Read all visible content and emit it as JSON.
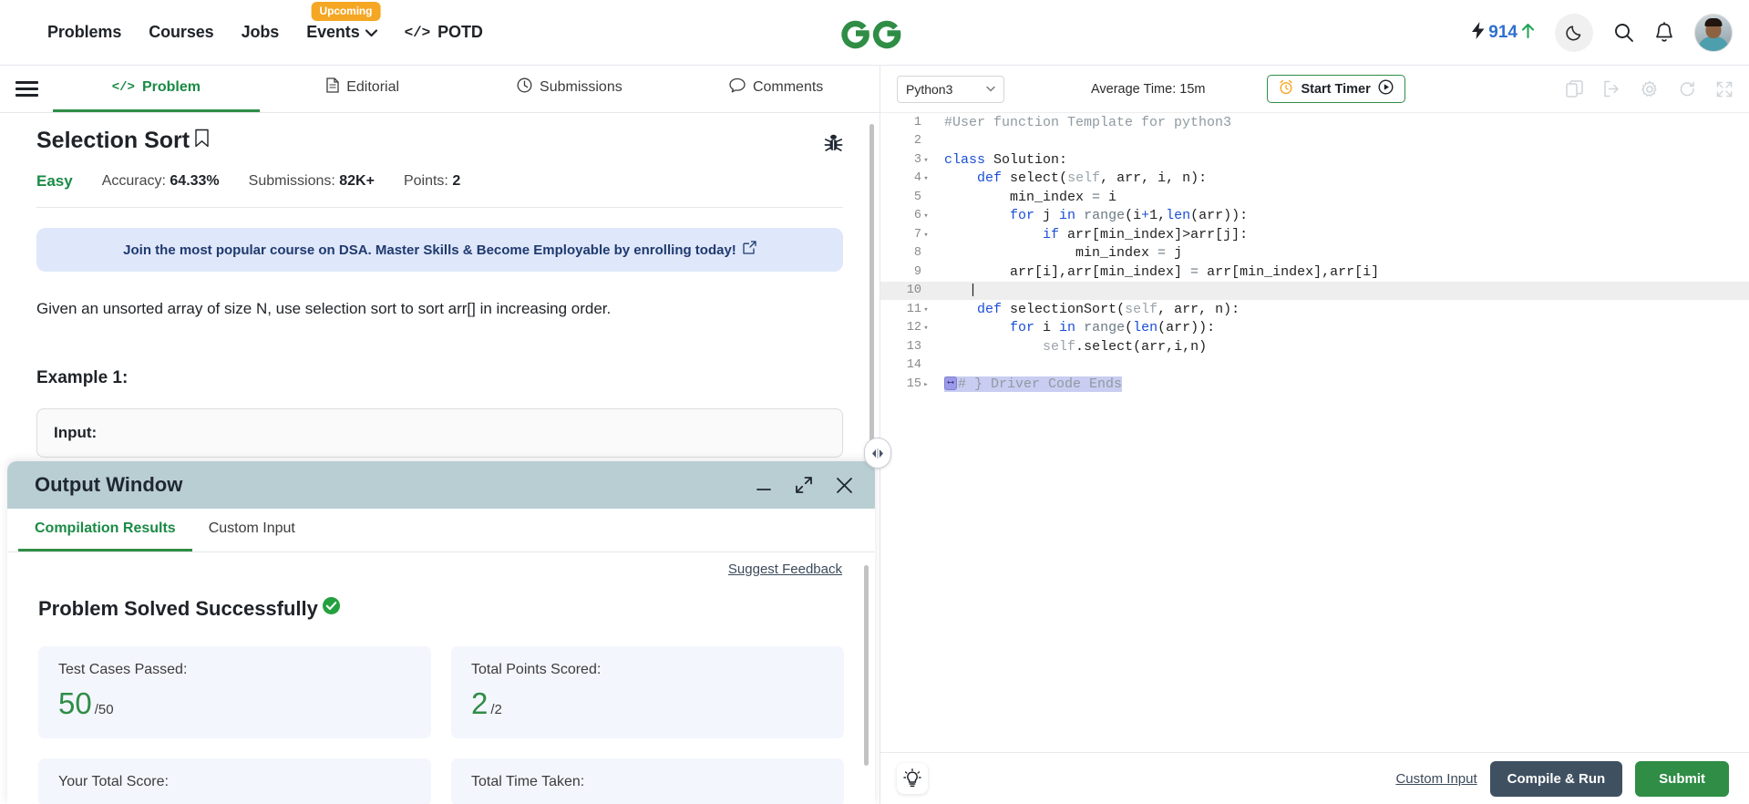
{
  "topnav": {
    "items": [
      {
        "label": "Problems",
        "has_caret": false,
        "badge": null
      },
      {
        "label": "Courses",
        "has_caret": false,
        "badge": null
      },
      {
        "label": "Jobs",
        "has_caret": false,
        "badge": null
      },
      {
        "label": "Events",
        "has_caret": true,
        "badge": "Upcoming"
      },
      {
        "label": "POTD",
        "has_caret": false,
        "badge": null
      }
    ],
    "events_badge": "Upcoming",
    "potd_glyph": "</>",
    "logo_alt": "GeeksforGeeks",
    "score": "914",
    "icons": {
      "bolt": "bolt-icon",
      "uparrow": "up-arrow-icon",
      "dark_mode": "moon-icon",
      "search": "search-icon",
      "notifications": "bell-icon",
      "avatar": "user-avatar"
    }
  },
  "problem_tabs": [
    {
      "label": "Problem",
      "icon": "code-icon",
      "active": true
    },
    {
      "label": "Editorial",
      "icon": "document-icon",
      "active": false
    },
    {
      "label": "Submissions",
      "icon": "clock-icon",
      "active": false
    },
    {
      "label": "Comments",
      "icon": "comment-icon",
      "active": false
    }
  ],
  "problem": {
    "title": "Selection Sort",
    "bookmark_icon": "bookmark-icon",
    "bug_icon": "bug-icon",
    "difficulty": "Easy",
    "stats": [
      {
        "label": "Accuracy: ",
        "value": "64.33%"
      },
      {
        "label": "Submissions: ",
        "value": "82K+"
      },
      {
        "label": "Points: ",
        "value": "2"
      }
    ],
    "promo_text": "Join the most popular course on DSA. Master Skills & Become Employable by enrolling today!",
    "promo_icon": "external-link-icon",
    "description": "Given an unsorted array of size N, use selection sort to sort arr[] in increasing order.",
    "example_heading": "Example 1:",
    "example_input_label": "Input:"
  },
  "editor": {
    "language": "Python3",
    "language_caret": "▾",
    "average_time": "Average Time: 15m",
    "timer_label": "Start Timer",
    "timer_icon": "alarm-clock-icon",
    "timer_play_icon": "play-circle-icon",
    "toolbar_icons": [
      "copy-icon",
      "import-icon",
      "settings-gear-icon",
      "reset-icon",
      "fullscreen-icon"
    ],
    "lines": [
      {
        "n": "1",
        "fold": "",
        "current": false
      },
      {
        "n": "2",
        "fold": "",
        "current": false
      },
      {
        "n": "3",
        "fold": "▾",
        "current": false
      },
      {
        "n": "4",
        "fold": "▾",
        "current": false
      },
      {
        "n": "5",
        "fold": "",
        "current": false
      },
      {
        "n": "6",
        "fold": "▾",
        "current": false
      },
      {
        "n": "7",
        "fold": "▾",
        "current": false
      },
      {
        "n": "8",
        "fold": "",
        "current": false
      },
      {
        "n": "9",
        "fold": "",
        "current": false
      },
      {
        "n": "10",
        "fold": "",
        "current": true
      },
      {
        "n": "11",
        "fold": "▾",
        "current": false
      },
      {
        "n": "12",
        "fold": "▾",
        "current": false
      },
      {
        "n": "13",
        "fold": "",
        "current": false
      },
      {
        "n": "14",
        "fold": "",
        "current": false
      },
      {
        "n": "15",
        "fold": "▸",
        "current": false
      }
    ],
    "code_text": [
      "#User function Template for python3",
      "",
      "class Solution:",
      "    def select(self, arr, i, n):",
      "        min_index = i",
      "        for j in range(i+1,len(arr)):",
      "            if arr[min_index]>arr[j]:",
      "                min_index = j",
      "        arr[i],arr[min_index] = arr[min_index],arr[i]",
      "",
      "    def selectionSort(self, arr, n):",
      "        for i in range(len(arr)):",
      "            self.select(arr,i,n)",
      "",
      "# } Driver Code Ends"
    ],
    "fold_widget_label": "⟷",
    "bulb_icon": "lightbulb-icon",
    "custom_input_link": "Custom Input",
    "compile_label": "Compile & Run",
    "submit_label": "Submit"
  },
  "output_window": {
    "title": "Output Window",
    "minimize_icon": "minimize-icon",
    "maximize_icon": "expand-icon",
    "close_icon": "close-icon",
    "tabs": [
      {
        "label": "Compilation Results",
        "active": true
      },
      {
        "label": "Custom Input",
        "active": false
      }
    ],
    "suggest_feedback": "Suggest Feedback",
    "status_text": "Problem Solved Successfully",
    "status_icon": "check-circle-icon",
    "cards": [
      {
        "label": "Test Cases Passed:",
        "big": "50",
        "small": "/50"
      },
      {
        "label": "Total Points Scored:",
        "big": "2",
        "small": "/2"
      },
      {
        "label": "Your Total Score:",
        "big": "",
        "small": ""
      },
      {
        "label": "Total Time Taken:",
        "big": "",
        "small": ""
      }
    ]
  },
  "colors": {
    "brand_green": "#2f8d46",
    "accent_blue": "#2f6fd0",
    "badge_orange": "#f5a623",
    "outwin_header": "#b9ced2",
    "compile_btn": "#3f5161",
    "promo_bg": "#dfe7fb"
  }
}
